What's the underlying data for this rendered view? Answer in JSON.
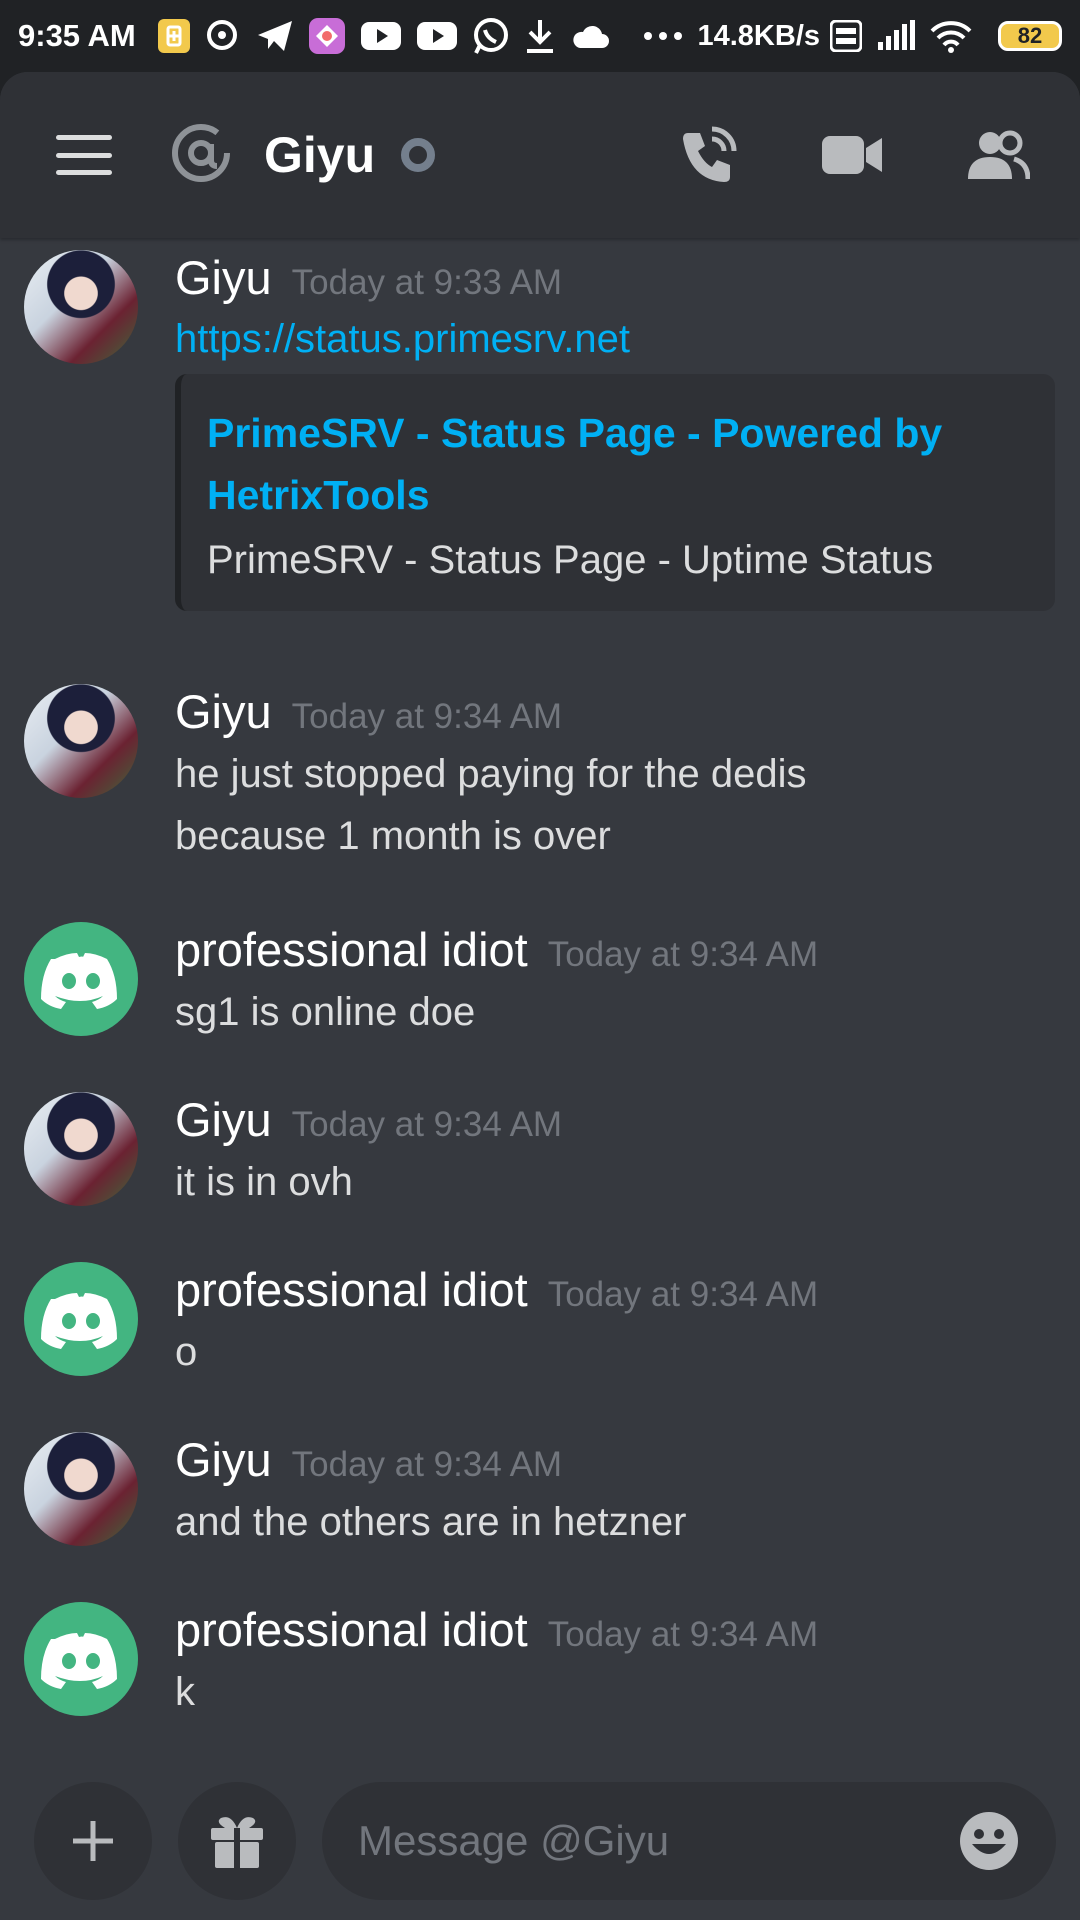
{
  "status_bar": {
    "time": "9:35 AM",
    "speed": "14.8KB/s",
    "battery": "82",
    "icons": [
      "battery-saver-icon",
      "chat-bubble-icon",
      "telegram-icon",
      "photos-icon",
      "youtube-icon",
      "youtube-icon",
      "whatsapp-icon",
      "download-icon",
      "cloud-icon",
      "more-dots-icon",
      "volte-icon",
      "signal-icon",
      "wifi-icon"
    ]
  },
  "header": {
    "title": "Giyu",
    "icons": [
      "menu-icon",
      "at-icon",
      "call-icon",
      "video-icon",
      "members-icon"
    ]
  },
  "messages": [
    {
      "author": "Giyu",
      "timestamp": "Today at 9:33 AM",
      "avatar": "giyu",
      "link": "https://status.primesrv.net",
      "embed": {
        "title": "PrimeSRV - Status Page - Powered by HetrixTools",
        "description": "PrimeSRV - Status Page - Uptime Status"
      }
    },
    {
      "author": "Giyu",
      "timestamp": "Today at 9:34 AM",
      "avatar": "giyu",
      "text": "he just stopped paying for the dedis because 1 month is over"
    },
    {
      "author": "professional idiot",
      "timestamp": "Today at 9:34 AM",
      "avatar": "discord",
      "text": "sg1 is online doe"
    },
    {
      "author": "Giyu",
      "timestamp": "Today at 9:34 AM",
      "avatar": "giyu",
      "text": "it is in ovh"
    },
    {
      "author": "professional idiot",
      "timestamp": "Today at 9:34 AM",
      "avatar": "discord",
      "text": "o"
    },
    {
      "author": "Giyu",
      "timestamp": "Today at 9:34 AM",
      "avatar": "giyu",
      "text": "and the others are in hetzner"
    },
    {
      "author": "professional idiot",
      "timestamp": "Today at 9:34 AM",
      "avatar": "discord",
      "text": "k"
    }
  ],
  "composer": {
    "placeholder": "Message @Giyu",
    "value": ""
  },
  "colors": {
    "background": "#36393f",
    "header": "#2f3136",
    "link": "#00b0f4",
    "discord_green": "#43b581",
    "muted": "#72767d"
  }
}
